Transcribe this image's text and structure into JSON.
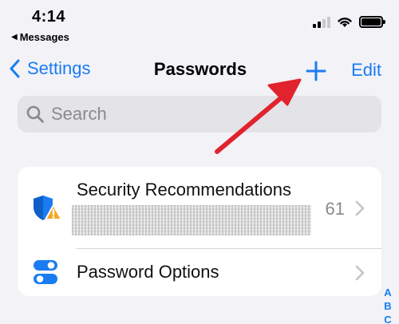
{
  "status_bar": {
    "time": "4:14",
    "back_app": "Messages",
    "back_arrow": "◀"
  },
  "nav": {
    "back_label": "Settings",
    "title": "Passwords",
    "edit_label": "Edit",
    "add_icon": "plus-icon"
  },
  "search": {
    "placeholder": "Search"
  },
  "list": {
    "rows": [
      {
        "title": "Security Recommendations",
        "count": "61",
        "icon": "shield-warning-icon"
      },
      {
        "title": "Password Options",
        "icon": "toggles-icon"
      }
    ]
  },
  "index_letters": [
    "A",
    "B",
    "C"
  ],
  "colors": {
    "accent": "#1a7cf2",
    "annotation_arrow": "#e1232e",
    "warning": "#f5a623"
  }
}
